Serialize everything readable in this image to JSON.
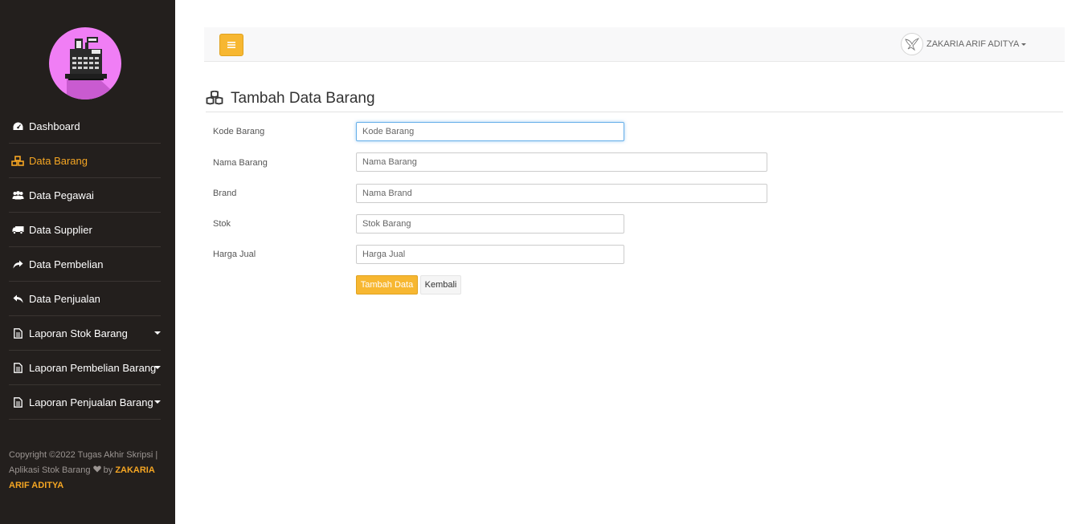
{
  "sidebar": {
    "items": [
      {
        "label": "Dashboard",
        "icon": "dashboard-icon"
      },
      {
        "label": "Data Barang",
        "icon": "cubes-icon",
        "active": true
      },
      {
        "label": "Data Pegawai",
        "icon": "users-icon"
      },
      {
        "label": "Data Supplier",
        "icon": "truck-icon"
      },
      {
        "label": "Data Pembelian",
        "icon": "share-icon"
      },
      {
        "label": "Data Penjualan",
        "icon": "reply-icon"
      },
      {
        "label": "Laporan Stok Barang",
        "icon": "file-text-icon",
        "dropdown": true
      },
      {
        "label": "Laporan Pembelian Barang",
        "icon": "file-text-icon",
        "dropdown": true
      },
      {
        "label": "Laporan Penjualan Barang",
        "icon": "file-text-icon",
        "dropdown": true
      }
    ],
    "copyright_prefix": "Copyright ©2022 Tugas Akhir Skripsi | Aplikasi Stok Barang",
    "copyright_by": "by",
    "copyright_author": "ZAKARIA ARIF ADITYA"
  },
  "topbar": {
    "user_name": "ZAKARIA ARIF ADITYA"
  },
  "page": {
    "title": "Tambah Data Barang"
  },
  "form": {
    "fields": [
      {
        "label": "Kode Barang",
        "placeholder": "Kode Barang"
      },
      {
        "label": "Nama Barang",
        "placeholder": "Nama Barang"
      },
      {
        "label": "Brand",
        "placeholder": "Nama Brand"
      },
      {
        "label": "Stok",
        "placeholder": "Stok Barang"
      },
      {
        "label": "Harga Jual",
        "placeholder": "Harga Jual"
      }
    ],
    "submit_label": "Tambah Data",
    "back_label": "Kembali"
  },
  "colors": {
    "sidebar_bg": "#231f1d",
    "accent": "#f7b731",
    "active_nav": "#f5a623",
    "logo_bg": "#f07ef5"
  }
}
